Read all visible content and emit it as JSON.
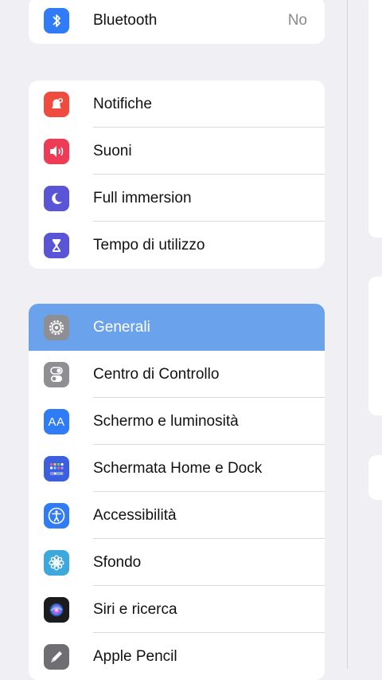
{
  "groups": [
    {
      "items": [
        {
          "label": "Bluetooth",
          "value": "No",
          "icon": "bluetooth-icon",
          "color": "#2f7cf6"
        }
      ]
    },
    {
      "items": [
        {
          "label": "Notifiche",
          "icon": "notifications-icon",
          "color": "#ef4b3f"
        },
        {
          "label": "Suoni",
          "icon": "speaker-icon",
          "color": "#ee3b56"
        },
        {
          "label": "Full immersion",
          "icon": "moon-icon",
          "color": "#5a54d6"
        },
        {
          "label": "Tempo di utilizzo",
          "icon": "hourglass-icon",
          "color": "#5a54d6"
        }
      ]
    },
    {
      "items": [
        {
          "label": "Generali",
          "icon": "gear-icon",
          "color": "#8e8e93",
          "selected": true
        },
        {
          "label": "Centro di Controllo",
          "icon": "toggles-icon",
          "color": "#8e8e93"
        },
        {
          "label": "Schermo e luminosità",
          "icon": "text-size-icon",
          "color": "#2f7cf6"
        },
        {
          "label": "Schermata Home e Dock",
          "icon": "app-grid-icon",
          "color": "#3c5fe0"
        },
        {
          "label": "Accessibilità",
          "icon": "accessibility-icon",
          "color": "#2f7cf6"
        },
        {
          "label": "Sfondo",
          "icon": "flower-icon",
          "color": "#3da8dc"
        },
        {
          "label": "Siri e ricerca",
          "icon": "siri-icon",
          "color": "#1c1c1e"
        },
        {
          "label": "Apple Pencil",
          "icon": "pencil-icon",
          "color": "#6e6e73"
        }
      ]
    }
  ],
  "icon_glyphs": {
    "text_size": "AA"
  }
}
